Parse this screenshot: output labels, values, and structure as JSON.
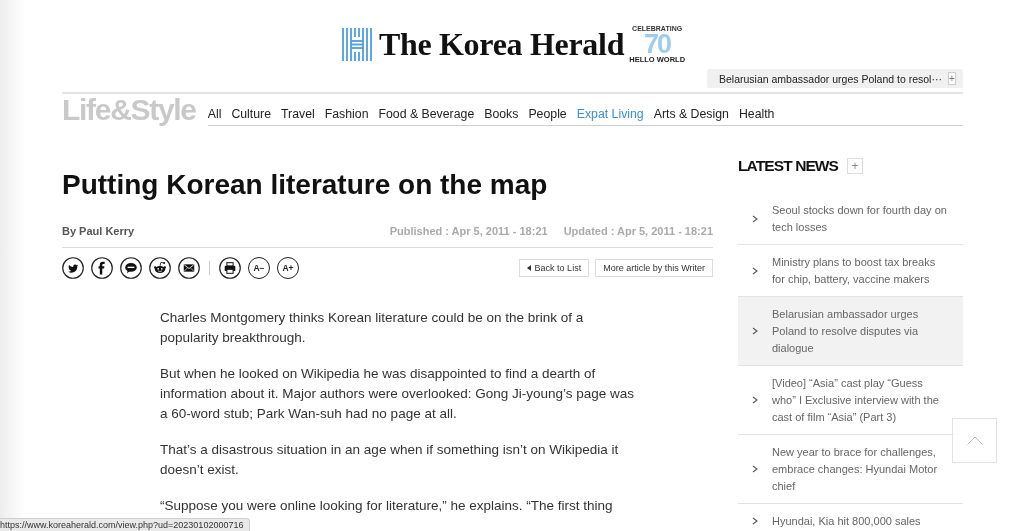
{
  "header": {
    "logo": {
      "title": "The Korea Herald",
      "badge_top": "CELEBRATING",
      "badge_number": "70",
      "badge_bottom": "HELLO WORLD"
    },
    "ticker": {
      "headline": "Belarusian ambassador urges Poland to resol···",
      "more": "+"
    }
  },
  "section": {
    "title": "Life&Style",
    "nav": [
      {
        "label": "All",
        "selected": false
      },
      {
        "label": "Culture",
        "selected": false
      },
      {
        "label": "Travel",
        "selected": false
      },
      {
        "label": "Fashion",
        "selected": false
      },
      {
        "label": "Food & Beverage",
        "selected": false
      },
      {
        "label": "Books",
        "selected": false
      },
      {
        "label": "People",
        "selected": false
      },
      {
        "label": "Expat Living",
        "selected": true
      },
      {
        "label": "Arts & Design",
        "selected": false
      },
      {
        "label": "Health",
        "selected": false
      }
    ]
  },
  "article": {
    "title": "Putting Korean literature on the map",
    "byline": "By Paul Kerry",
    "published": "Published : Apr 5, 2011 - 18:21",
    "updated": "Updated : Apr 5, 2011 - 18:21",
    "font_buttons": [
      "A−",
      "A+"
    ],
    "buttons": [
      "Back to List",
      "More article by this Writer"
    ],
    "paragraphs": [
      "Charles Montgomery thinks Korean literature could be on the brink of a popularity breakthrough.",
      "But when he looked on Wikipedia he was disappointed to find a dearth of information about it. Major authors were overlooked: Gong Ji-young’s page was a 60-word stub; Park Wan-suh had no page at all.",
      "That’s a disastrous situation in an age when if something isn’t on Wikipedia it doesn’t exist.",
      "“Suppose you were online looking for literature,” he explains. “The first thing"
    ]
  },
  "latest_news": {
    "title": "LATEST NEWS",
    "more": "+",
    "items": [
      {
        "headline": "Seoul stocks down for fourth day on tech losses",
        "selected": false
      },
      {
        "headline": "Ministry plans to boost tax breaks for chip, battery, vaccine makers",
        "selected": false
      },
      {
        "headline": "Belarusian ambassador urges Poland to resolve disputes via dialogue",
        "selected": true
      },
      {
        "headline": "[Video] “Asia” cast play “Guess who” I Exclusive interview with the cast of film “Asia” (Part 3)",
        "selected": false
      },
      {
        "headline": "New year to brace for challenges, embrace changes: Hyundai Motor chief",
        "selected": false
      },
      {
        "headline": "Hyundai, Kia hit 800,000 sales",
        "selected": false
      }
    ]
  },
  "status_bar": {
    "url": "https://www.koreaherald.com/view.php?ud=20230102000716"
  }
}
